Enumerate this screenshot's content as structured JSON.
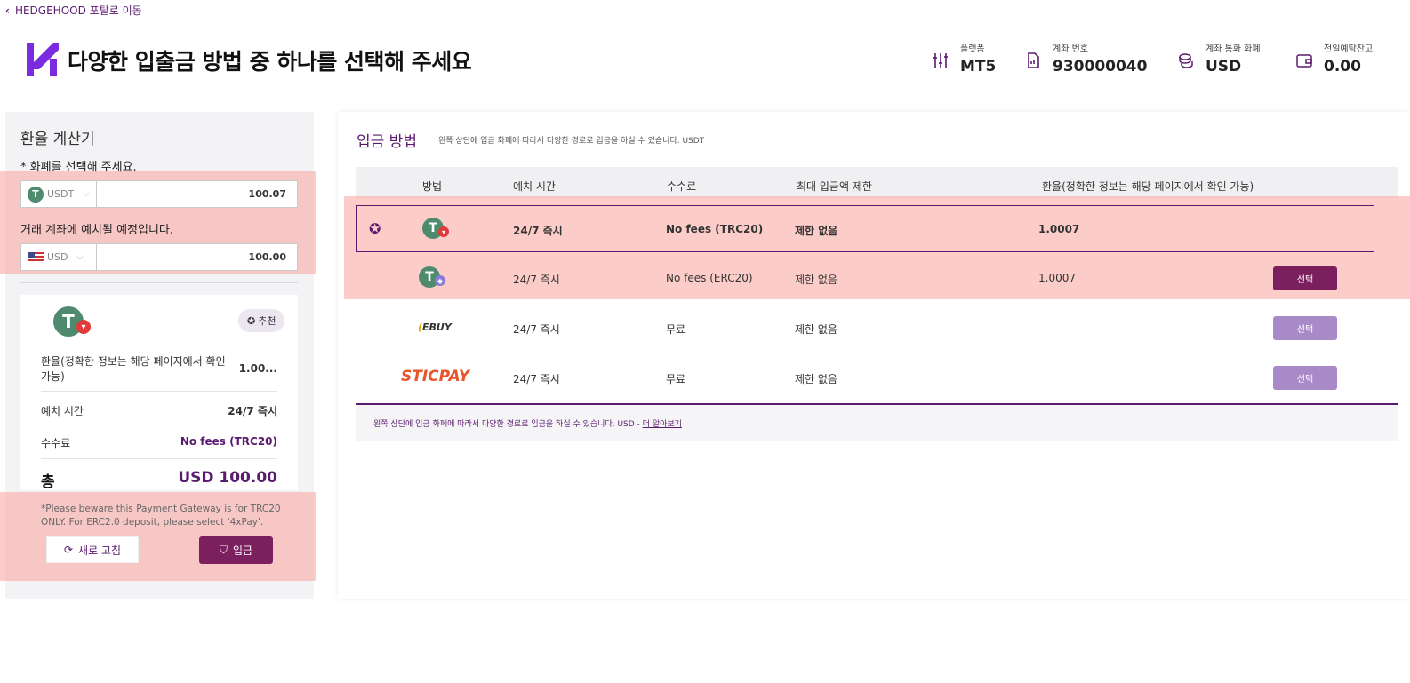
{
  "nav": {
    "back_label": "HEDGEHOOD 포탈로 이동"
  },
  "header": {
    "title": "다양한 입출금 방법 중 하나를 선택해 주세요",
    "account": [
      {
        "label": "플랫폼",
        "value": "MT5",
        "icon": "sliders-icon"
      },
      {
        "label": "계좌 번호",
        "value": "930000040",
        "icon": "document-icon"
      },
      {
        "label": "계좌 통화 화폐",
        "value": "USD",
        "icon": "coins-icon"
      },
      {
        "label": "전일예탁잔고",
        "value": "0.00",
        "icon": "wallet-icon"
      }
    ]
  },
  "calculator": {
    "title": "환율 계산기",
    "select_note": "* 화폐를 선택해 주세요.",
    "from_currency": "USDT",
    "from_amount": "100.07",
    "deposit_note": "거래 계좌에 예치될 예정입니다.",
    "to_currency": "USD",
    "to_amount": "100.00",
    "card": {
      "badge": "추천",
      "rate_label": "환율(정확한 정보는 해당 페이지에서 확인 가능)",
      "rate_value": "1.00...",
      "time_label": "예치 시간",
      "time_value": "24/7 즉시",
      "fee_label": "수수료",
      "fee_value": "No fees (TRC20)",
      "total_label": "총",
      "total_value": "USD 100.00"
    },
    "warning": "*Please beware this Payment Gateway is for TRC20 ONLY. For ERC2.0 deposit, please select '4xPay'.",
    "refresh_label": "새로 고침",
    "deposit_label": "입금"
  },
  "methods": {
    "title": "입금 방법",
    "subtitle": "왼쪽 상단에 입금 화폐에 따라서 다양한 경로로 입금을 하실 수 있습니다. USDT",
    "headers": {
      "method": "방법",
      "time": "예치 시간",
      "fee": "수수료",
      "limit": "최대 입금액 제한",
      "rate": "환율(정확한 정보는 해당 페이지에서 확인 가능)"
    },
    "rows": [
      {
        "method": "USDT TRC20",
        "time": "24/7 즉시",
        "fee": "No fees (TRC20)",
        "limit": "제한 없음",
        "rate": "1.0007",
        "select": ""
      },
      {
        "method": "USDT ERC20",
        "time": "24/7 즉시",
        "fee": "No fees (ERC20)",
        "limit": "제한 없음",
        "rate": "1.0007",
        "select": "선택"
      },
      {
        "method": "EBUY",
        "time": "24/7 즉시",
        "fee": "무료",
        "limit": "제한 없음",
        "rate": "",
        "select": "선택"
      },
      {
        "method": "STICPAY",
        "time": "24/7 즉시",
        "fee": "무료",
        "limit": "제한 없음",
        "rate": "",
        "select": "선택"
      }
    ],
    "footer_text": "왼쪽 상단에 입금 화폐에 따라서 다양한 경로로 입금을 하실 수 있습니다. USD -",
    "footer_link": "더 알아보기"
  }
}
